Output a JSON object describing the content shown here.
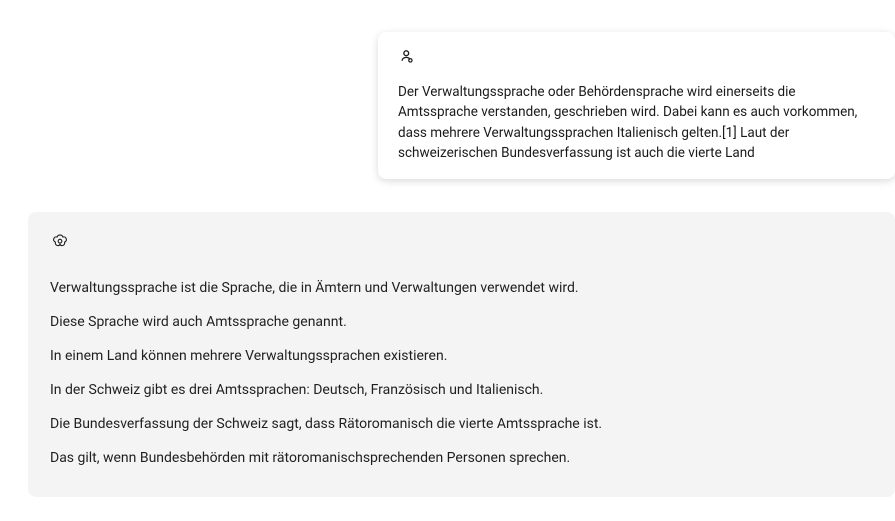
{
  "user_message": {
    "text": "Der Verwaltungssprache oder Behördensprache wird einerseits die Amtssprache verstanden, geschrieben wird. Dabei kann es auch vorkommen, dass mehrere Verwaltungssprachen Italienisch gelten.[1] Laut der schweizerischen Bundesverfassung ist auch die vierte Land"
  },
  "assistant_message": {
    "paragraphs": [
      "Verwaltungssprache ist die Sprache, die in Ämtern und Verwaltungen verwendet wird.",
      "Diese Sprache wird auch Amtssprache genannt.",
      "In einem Land können mehrere Verwaltungssprachen existieren.",
      "In der Schweiz gibt es drei Amtssprachen: Deutsch, Französisch und Italienisch.",
      "Die Bundesverfassung der Schweiz sagt, dass Rätoromanisch die vierte Amtssprache ist.",
      "Das gilt, wenn Bundesbehörden mit rätoromanischsprechenden Personen sprechen."
    ]
  }
}
